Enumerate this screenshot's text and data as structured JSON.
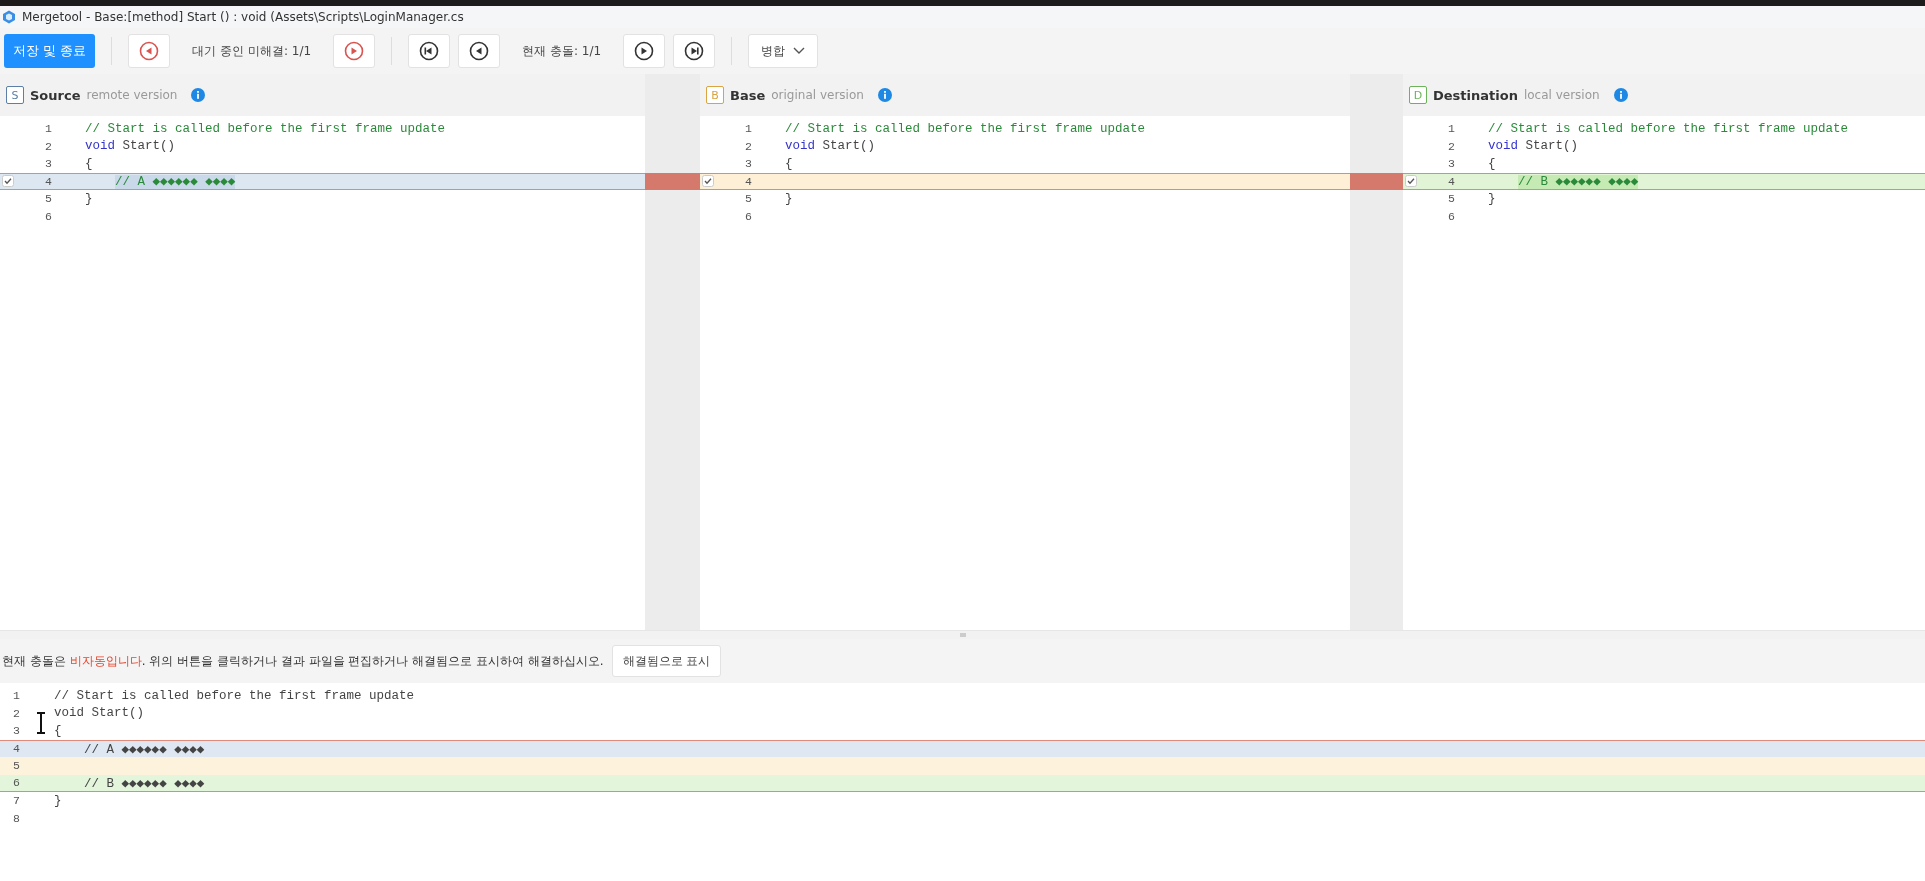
{
  "window": {
    "title": "Mergetool - Base:[method] Start () : void (Assets\\Scripts\\LoginManager.cs"
  },
  "toolbar": {
    "save_button": "저장 및 종료",
    "pending_label": "대기 중인 미해결: 1/1",
    "conflict_label": "현재 충돌: 1/1",
    "merge_dropdown": "병합"
  },
  "panes": [
    {
      "letter": "S",
      "title": "Source",
      "subtitle": "remote version",
      "color": "#5b7fa6",
      "lines": [
        {
          "number": "1",
          "kind": "normal",
          "indented": false,
          "tokens": [
            {
              "text": "// Start is called before the first frame update",
              "kind": "comment"
            }
          ]
        },
        {
          "number": "2",
          "kind": "normal",
          "indented": false,
          "tokens": [
            {
              "text": "void",
              "kind": "keyword"
            },
            {
              "text": " Start()",
              "kind": "plain"
            }
          ]
        },
        {
          "number": "3",
          "kind": "normal",
          "indented": false,
          "tokens": [
            {
              "text": "{",
              "kind": "plain"
            }
          ]
        },
        {
          "number": "4",
          "kind": "conflict",
          "checked": true,
          "indented": true,
          "tokens": [
            {
              "text": "// A ◆◆◆◆◆◆ ◆◆◆◆",
              "kind": "marked"
            }
          ]
        },
        {
          "number": "5",
          "kind": "normal",
          "indented": false,
          "tokens": [
            {
              "text": "}",
              "kind": "plain"
            }
          ]
        },
        {
          "number": "6",
          "kind": "normal"
        }
      ]
    },
    {
      "letter": "B",
      "title": "Base",
      "subtitle": "original version",
      "color": "#d9a441",
      "lines": [
        {
          "number": "1",
          "kind": "normal",
          "indented": false,
          "tokens": [
            {
              "text": "// Start is called before the first frame update",
              "kind": "comment"
            }
          ]
        },
        {
          "number": "2",
          "kind": "normal",
          "indented": false,
          "tokens": [
            {
              "text": "void",
              "kind": "keyword"
            },
            {
              "text": " Start()",
              "kind": "plain"
            }
          ]
        },
        {
          "number": "3",
          "kind": "normal",
          "indented": false,
          "tokens": [
            {
              "text": "{",
              "kind": "plain"
            }
          ]
        },
        {
          "number": "4",
          "kind": "conflict",
          "checked": true
        },
        {
          "number": "5",
          "kind": "normal",
          "indented": false,
          "tokens": [
            {
              "text": "}",
              "kind": "plain"
            }
          ]
        },
        {
          "number": "6",
          "kind": "normal"
        }
      ]
    },
    {
      "letter": "D",
      "title": "Destination",
      "subtitle": "local version",
      "color": "#6db35a",
      "lines": [
        {
          "number": "1",
          "kind": "normal",
          "indented": false,
          "tokens": [
            {
              "text": "// Start is called before the first frame update",
              "kind": "comment"
            }
          ]
        },
        {
          "number": "2",
          "kind": "normal",
          "indented": false,
          "tokens": [
            {
              "text": "void",
              "kind": "keyword"
            },
            {
              "text": " Start()",
              "kind": "plain"
            }
          ]
        },
        {
          "number": "3",
          "kind": "normal",
          "indented": false,
          "tokens": [
            {
              "text": "{",
              "kind": "plain"
            }
          ]
        },
        {
          "number": "4",
          "kind": "conflict",
          "checked": true,
          "indented": true,
          "tokens": [
            {
              "text": "// B ◆◆◆◆◆◆ ◆◆◆◆",
              "kind": "marked"
            }
          ]
        },
        {
          "number": "5",
          "kind": "normal",
          "indented": false,
          "tokens": [
            {
              "text": "}",
              "kind": "plain"
            }
          ]
        },
        {
          "number": "6",
          "kind": "normal"
        }
      ]
    }
  ],
  "message": {
    "parts": [
      {
        "text": "현재 충돌은 ",
        "kind": "plain"
      },
      {
        "text": "비자동입니다",
        "kind": "alert"
      },
      {
        "text": ". 위의 버튼을 클릭하거나 결과 파일을 편집하거나 해결됨으로 표시하여 해결하십시오.",
        "kind": "plain"
      }
    ],
    "button": "해결됨으로 표시"
  },
  "result": {
    "lines": [
      {
        "number": "1",
        "kind": "normal",
        "indented": false,
        "text": "// Start is called before the first frame update"
      },
      {
        "number": "2",
        "kind": "normal",
        "indented": false,
        "text": "void Start()"
      },
      {
        "number": "3",
        "kind": "normal",
        "indented": false,
        "text": "{"
      },
      {
        "number": "4",
        "kind": "source",
        "indented": true,
        "text": "// A ◆◆◆◆◆◆ ◆◆◆◆"
      },
      {
        "number": "5",
        "kind": "base"
      },
      {
        "number": "6",
        "kind": "dest",
        "indented": true,
        "text": "// B ◆◆◆◆◆◆ ◆◆◆◆"
      },
      {
        "number": "7",
        "kind": "normal",
        "indented": false,
        "text": "}"
      },
      {
        "number": "8",
        "kind": "normal"
      }
    ]
  }
}
